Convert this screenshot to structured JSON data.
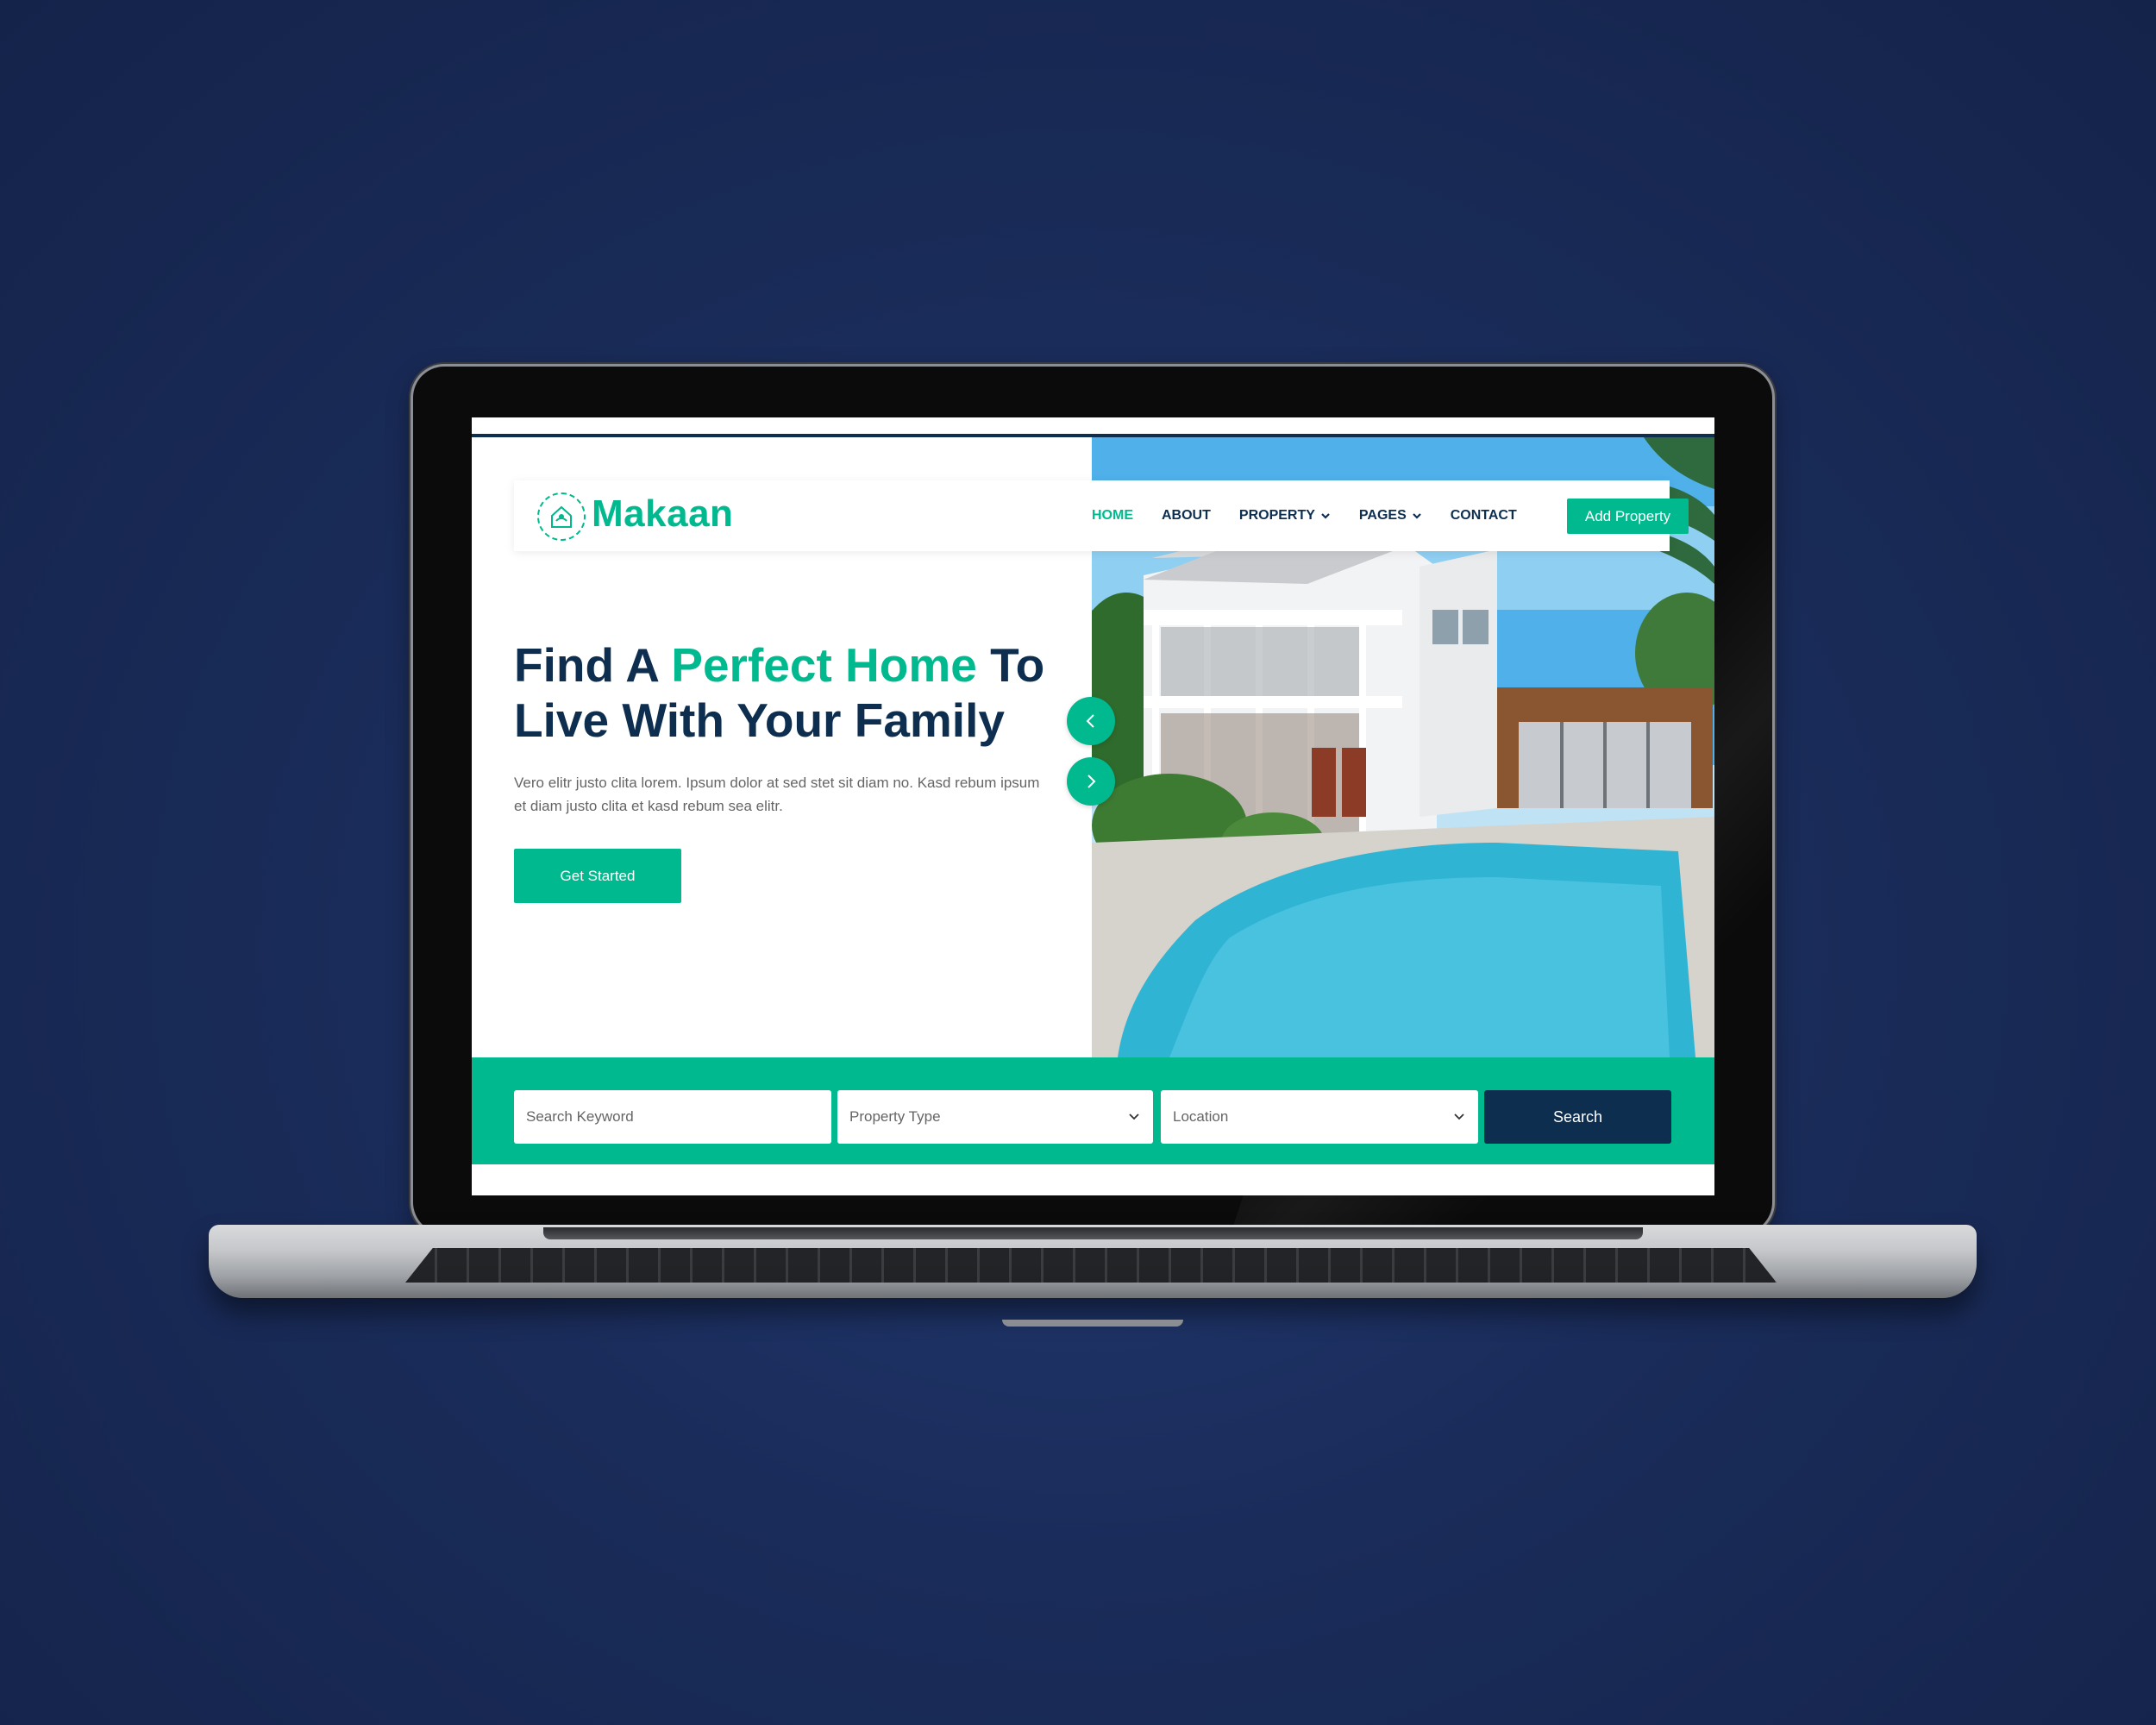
{
  "colors": {
    "primary": "#00b98e",
    "dark": "#0e2e50",
    "text": "#666565",
    "background": "#1a2c5a"
  },
  "brand": {
    "name": "Makaan",
    "logo_icon": "house-handshake-icon"
  },
  "nav": {
    "items": [
      {
        "label": "HOME",
        "active": true
      },
      {
        "label": "ABOUT"
      },
      {
        "label": "PROPERTY",
        "dropdown": true
      },
      {
        "label": "PAGES",
        "dropdown": true
      },
      {
        "label": "CONTACT"
      }
    ],
    "cta_label": "Add Property"
  },
  "hero": {
    "title_part1": "Find A ",
    "title_accent": "Perfect Home",
    "title_part2": " To Live With Your Family",
    "description": "Vero elitr justo clita lorem. Ipsum dolor at sed stet sit diam no. Kasd rebum ipsum et diam justo clita et kasd rebum sea elitr.",
    "button_label": "Get Started",
    "carousel_prev_icon": "chevron-left-icon",
    "carousel_next_icon": "chevron-right-icon",
    "image_subject": "luxury-house-with-pool"
  },
  "search": {
    "keyword_placeholder": "Search Keyword",
    "property_type_value": "Property Type",
    "location_value": "Location",
    "button_label": "Search"
  }
}
